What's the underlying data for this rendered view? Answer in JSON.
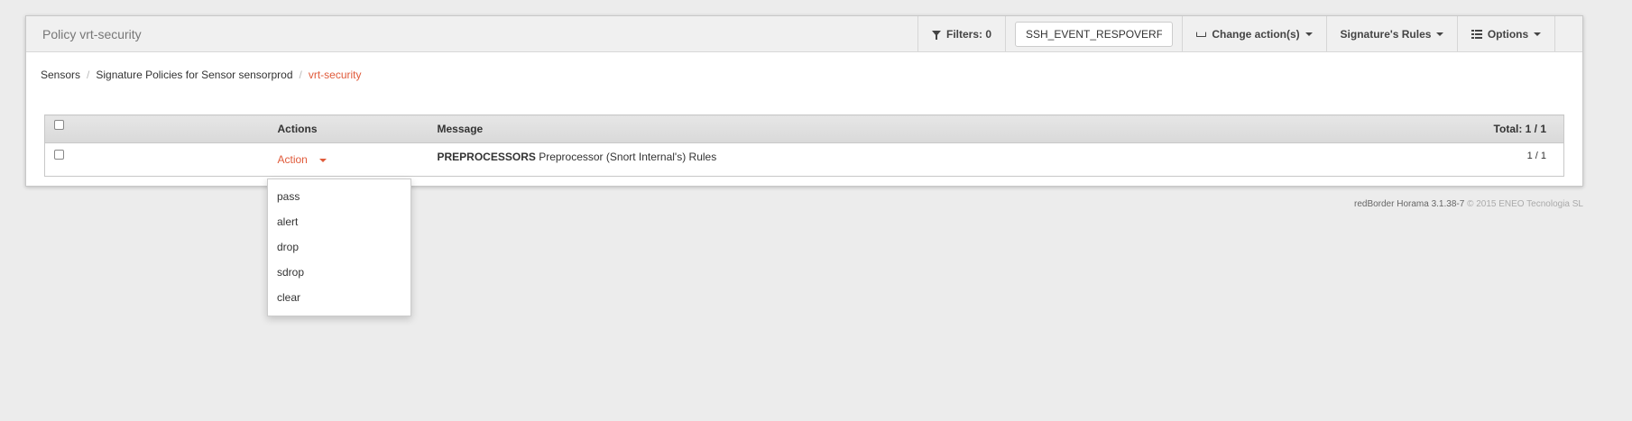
{
  "toolbar": {
    "title": "Policy vrt-security",
    "filters_label": "Filters: 0",
    "search_value": "SSH_EVENT_RESPOVERFLOW",
    "change_actions_label": "Change action(s)",
    "signature_rules_label": "Signature's Rules",
    "options_label": "Options"
  },
  "breadcrumb": {
    "items": [
      "Sensors",
      "Signature Policies for Sensor sensorprod",
      "vrt-security"
    ],
    "separator": "/"
  },
  "table": {
    "headers": {
      "actions": "Actions",
      "message": "Message",
      "total": "Total: 1 / 1"
    },
    "rows": [
      {
        "action": "Action",
        "message_bold": "PREPROCESSORS",
        "message_rest": " Preprocessor (Snort Internal's) Rules",
        "count": "1 / 1"
      }
    ]
  },
  "action_menu": {
    "options": [
      "pass",
      "alert",
      "drop",
      "sdrop",
      "clear"
    ]
  },
  "footer": {
    "product": "redBorder Horama 3.1.38-7",
    "copyright": "© 2015 ENEO Tecnologia SL"
  },
  "colors": {
    "accent": "#e05a3a",
    "toolbar_bg": "#f0f0f0",
    "page_bg": "#ececec"
  }
}
